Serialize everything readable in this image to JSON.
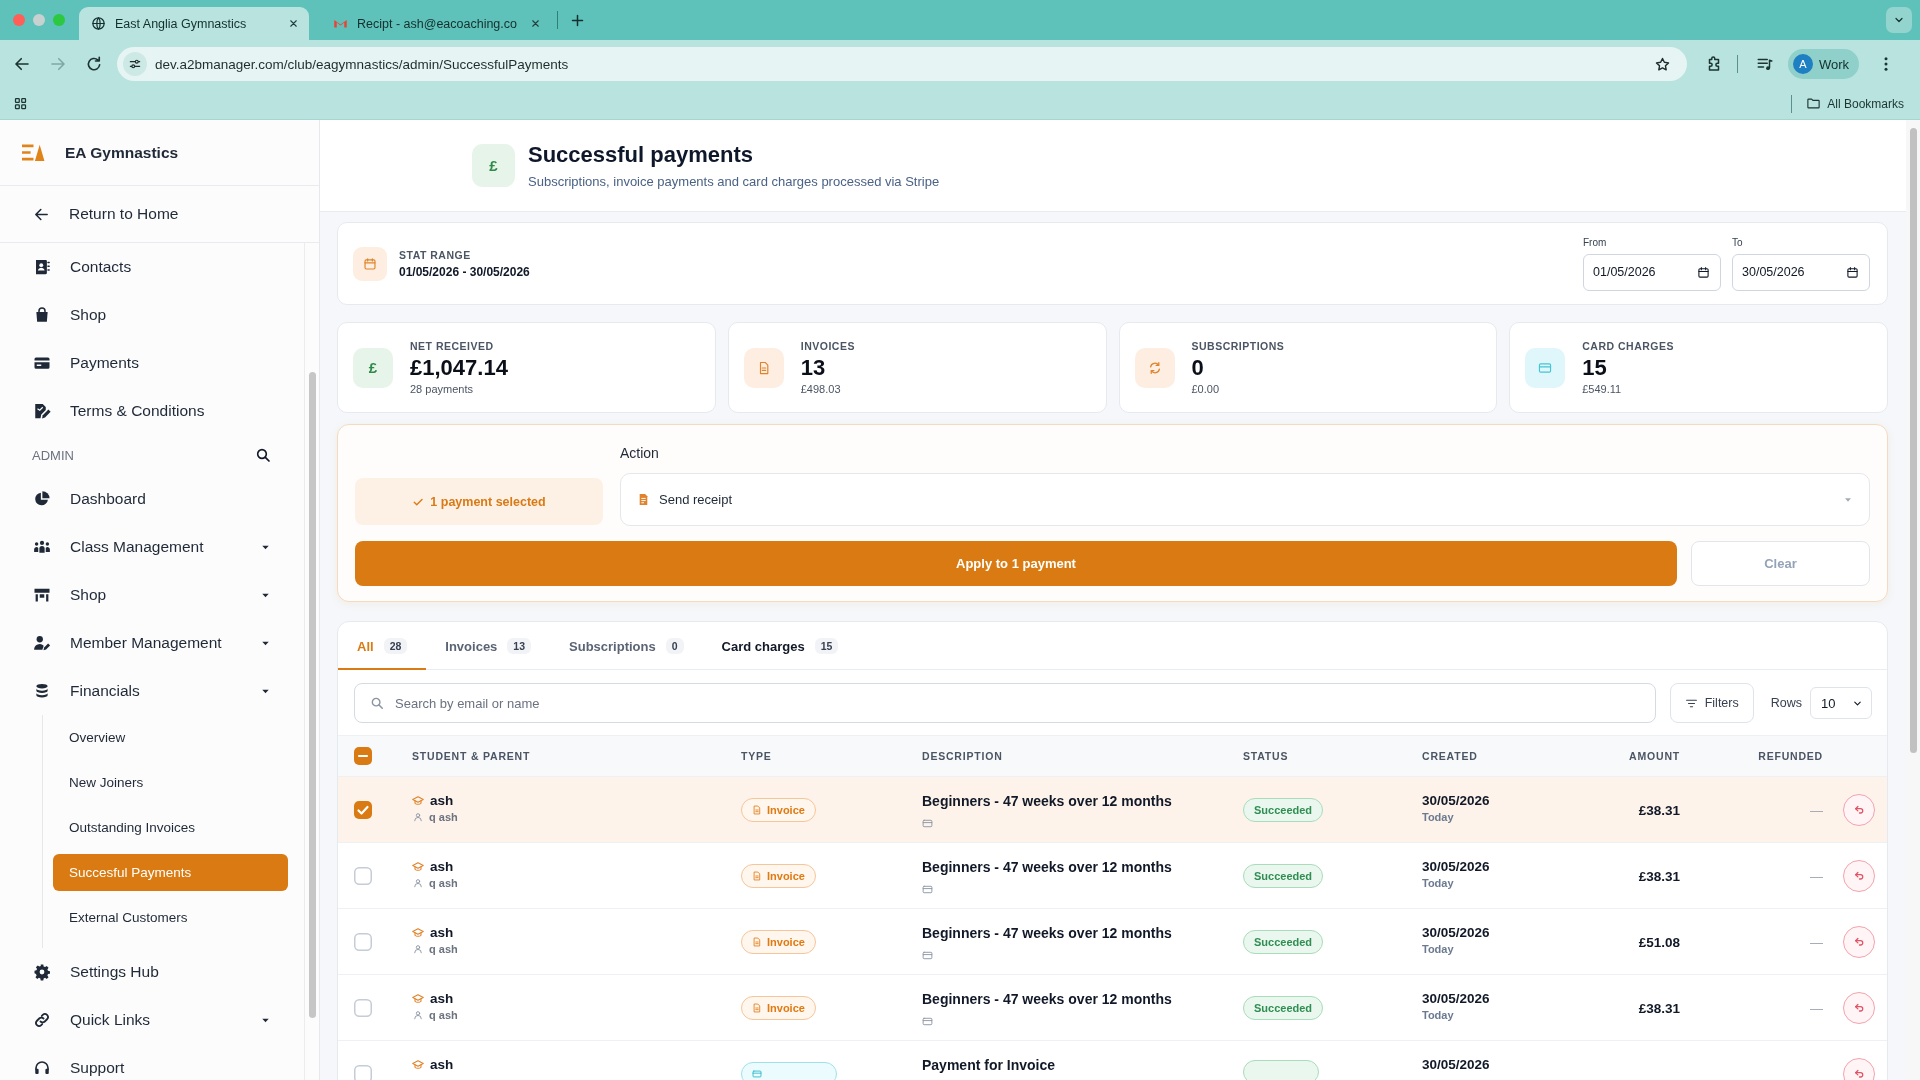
{
  "browser": {
    "tabs": [
      {
        "kind": "site",
        "title": "East Anglia Gymnastics",
        "selected": true
      },
      {
        "kind": "mail",
        "title": "Recipt - ash@eacoaching.co",
        "selected": false
      }
    ],
    "url": "dev.a2bmanager.com/club/eagymnastics/admin/SuccessfulPayments",
    "profile": {
      "initial": "A",
      "label": "Work"
    },
    "bookmarks": "All Bookmarks"
  },
  "sidebar": {
    "brand": "EA Gymnastics",
    "back_link": "Return to Home",
    "items": [
      {
        "kind": "link",
        "label": "Contacts",
        "selected": false
      },
      {
        "kind": "link",
        "label": "Shop",
        "selected": false
      },
      {
        "kind": "link",
        "label": "Payments",
        "selected": false
      },
      {
        "kind": "link",
        "label": "Terms & Conditions",
        "selected": false
      },
      {
        "kind": "section",
        "label": "ADMIN"
      },
      {
        "kind": "link",
        "label": "Dashboard",
        "selected": false
      },
      {
        "kind": "group",
        "label": "Class Management"
      },
      {
        "kind": "group",
        "label": "Shop"
      },
      {
        "kind": "group",
        "label": "Member Management"
      },
      {
        "kind": "group",
        "label": "Financials",
        "children": [
          {
            "label": "Overview",
            "selected": false
          },
          {
            "label": "New Joiners",
            "selected": false
          },
          {
            "label": "Outstanding Invoices",
            "selected": false
          },
          {
            "label": "Succesful Payments",
            "selected": true
          },
          {
            "label": "External Customers",
            "selected": false
          }
        ]
      },
      {
        "kind": "link",
        "label": "Settings Hub",
        "selected": false
      },
      {
        "kind": "group",
        "label": "Quick Links"
      },
      {
        "kind": "link",
        "label": "Support",
        "selected": false
      }
    ]
  },
  "page_header": {
    "icon": "£",
    "title": "Successful payments",
    "subtitle": "Subscriptions, invoice payments and card charges processed via Stripe"
  },
  "stat_range": {
    "label": "STAT RANGE",
    "value": "01/05/2026 - 30/05/2026",
    "from": {
      "label": "From",
      "value": "01/05/2026"
    },
    "to": {
      "label": "To",
      "value": "30/05/2026"
    }
  },
  "stats": [
    {
      "kind": "net",
      "symbol": "£",
      "label": "NET RECEIVED",
      "value": "£1,047.14",
      "sub": "28 payments"
    },
    {
      "kind": "invoices",
      "label": "INVOICES",
      "value": "13",
      "sub": "£498.03"
    },
    {
      "kind": "subscriptions",
      "label": "SUBSCRIPTIONS",
      "value": "0",
      "sub": "£0.00"
    },
    {
      "kind": "card_charges",
      "label": "CARD CHARGES",
      "value": "15",
      "sub": "£549.11"
    }
  ],
  "bulk_action": {
    "selection": "1 payment selected",
    "action_label": "Action",
    "action_value": "Send receipt",
    "apply": "Apply to 1 payment",
    "clear": "Clear"
  },
  "tabs": [
    {
      "label": "All",
      "count": "28",
      "selected": true,
      "hovered": false
    },
    {
      "label": "Invoices",
      "count": "13",
      "selected": false,
      "hovered": false
    },
    {
      "label": "Subscriptions",
      "count": "0",
      "selected": false,
      "hovered": false
    },
    {
      "label": "Card charges",
      "count": "15",
      "selected": false,
      "hovered": true
    }
  ],
  "table_toolbar": {
    "placeholder": "Search by email or name",
    "filters": "Filters",
    "rows_label": "Rows",
    "rows_value": "10"
  },
  "table": {
    "select_all": {
      "indeterminate": true
    },
    "columns": [
      "STUDENT & PARENT",
      "TYPE",
      "DESCRIPTION",
      "STATUS",
      "CREATED",
      "AMOUNT",
      "REFUNDED"
    ],
    "rows": [
      {
        "selected": true,
        "student": "ash",
        "parent": "q ash",
        "type": {
          "kind": "invoice",
          "label": "Invoice"
        },
        "description": "Beginners - 47 weeks over 12 months",
        "status": {
          "kind": "succeeded",
          "label": "Succeeded"
        },
        "created": "30/05/2026",
        "created_note": "Today",
        "amount": "£38.31",
        "refunded": "—"
      },
      {
        "selected": false,
        "student": "ash",
        "parent": "q ash",
        "type": {
          "kind": "invoice",
          "label": "Invoice"
        },
        "description": "Beginners - 47 weeks over 12 months",
        "status": {
          "kind": "succeeded",
          "label": "Succeeded"
        },
        "created": "30/05/2026",
        "created_note": "Today",
        "amount": "£38.31",
        "refunded": "—"
      },
      {
        "selected": false,
        "student": "ash",
        "parent": "q ash",
        "type": {
          "kind": "invoice",
          "label": "Invoice"
        },
        "description": "Beginners - 47 weeks over 12 months",
        "status": {
          "kind": "succeeded",
          "label": "Succeeded"
        },
        "created": "30/05/2026",
        "created_note": "Today",
        "amount": "£51.08",
        "refunded": "—"
      },
      {
        "selected": false,
        "student": "ash",
        "parent": "q ash",
        "type": {
          "kind": "invoice",
          "label": "Invoice"
        },
        "description": "Beginners - 47 weeks over 12 months",
        "status": {
          "kind": "succeeded",
          "label": "Succeeded"
        },
        "created": "30/05/2026",
        "created_note": "Today",
        "amount": "£38.31",
        "refunded": "—"
      },
      {
        "selected": false,
        "student": "ash",
        "type": {
          "kind": "card_charge"
        },
        "description": "Payment for Invoice",
        "status": {
          "kind": "succeeded"
        },
        "created": "30/05/2026"
      }
    ]
  }
}
